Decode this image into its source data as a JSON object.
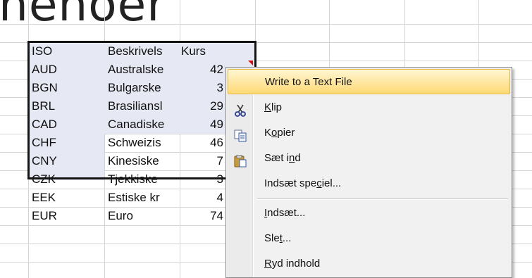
{
  "background_title_fragment": "nenoer",
  "table": {
    "header": [
      "ISO",
      "Beskrivels",
      "Kurs"
    ],
    "rows": [
      [
        "AUD",
        "Australske",
        "42"
      ],
      [
        "BGN",
        "Bulgarske",
        "3"
      ],
      [
        "BRL",
        "Brasiliansl",
        "29"
      ],
      [
        "CAD",
        "Canadiske",
        "49"
      ],
      [
        "CHF",
        "Schweizis",
        "46"
      ],
      [
        "CNY",
        "Kinesiske",
        "7"
      ],
      [
        "CZK",
        "Tjekkiske",
        "3"
      ],
      [
        "EEK",
        "Estiske kr",
        "4"
      ],
      [
        "EUR",
        "Euro",
        "74"
      ]
    ]
  },
  "context_menu": {
    "items": [
      {
        "label": "Write to a Text File",
        "highlighted": true,
        "icon": ""
      },
      {
        "pre": "",
        "key": "K",
        "post": "lip",
        "icon": "scissors-icon"
      },
      {
        "pre": "K",
        "key": "o",
        "post": "pier",
        "icon": "copy-icon"
      },
      {
        "pre": "Sæt i",
        "key": "n",
        "post": "d",
        "icon": "paste-icon"
      },
      {
        "pre": "Indsæt spe",
        "key": "c",
        "post": "iel...",
        "icon": ""
      },
      {
        "pre": "",
        "key": "I",
        "post": "ndsæt...",
        "icon": ""
      },
      {
        "pre": "Sle",
        "key": "t",
        "post": "...",
        "icon": ""
      },
      {
        "pre": "",
        "key": "R",
        "post": "yd indhold",
        "icon": ""
      }
    ]
  },
  "colors": {
    "selection_fill": "#e6e8f3",
    "selection_border": "#141414",
    "menu_highlight": "#ffd974",
    "comment_marker": "#d01010"
  }
}
